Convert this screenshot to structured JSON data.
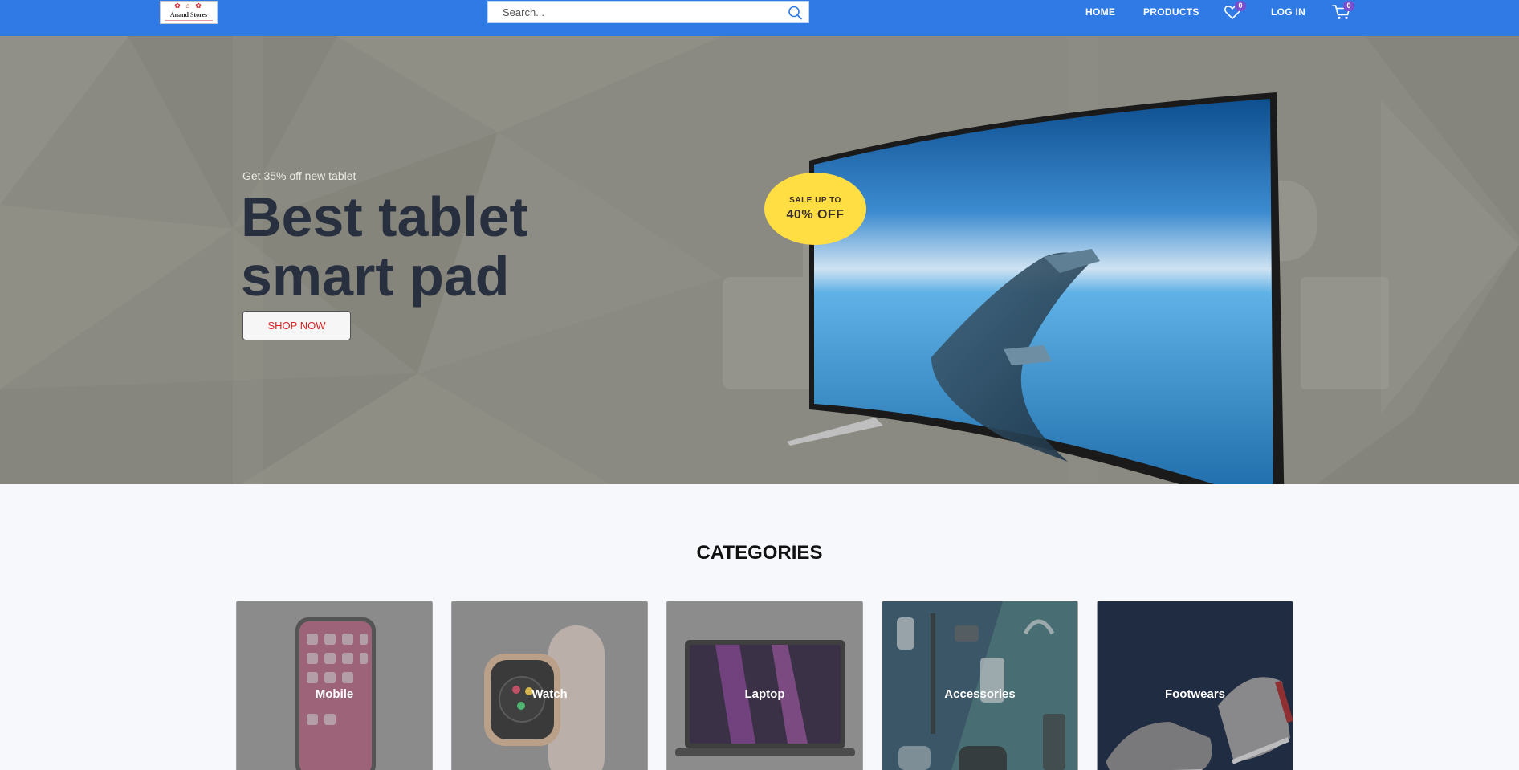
{
  "brand": {
    "logo_text": "Anand Stores",
    "accent_color": "#2f7ae5"
  },
  "search": {
    "placeholder": "Search...",
    "value": ""
  },
  "nav": {
    "home": "HOME",
    "products": "PRODUCTS",
    "wishlist_count": "0",
    "login": "LOG IN",
    "cart_count": "0"
  },
  "hero": {
    "subtitle": "Get 35% off new tablet",
    "title_line1": "Best tablet",
    "title_line2": "smart pad",
    "cta": "SHOP NOW",
    "badge_top": "SALE UP TO",
    "badge_main": "40% OFF",
    "background_color": "#8b8a82",
    "badge_color": "#ffde44"
  },
  "categories": {
    "heading": "CATEGORIES",
    "items": [
      {
        "label": "Mobile",
        "icon": "phone-image"
      },
      {
        "label": "Watch",
        "icon": "watch-image"
      },
      {
        "label": "Laptop",
        "icon": "laptop-image"
      },
      {
        "label": "Accessories",
        "icon": "accessories-image"
      },
      {
        "label": "Footwears",
        "icon": "shoes-image"
      }
    ]
  }
}
